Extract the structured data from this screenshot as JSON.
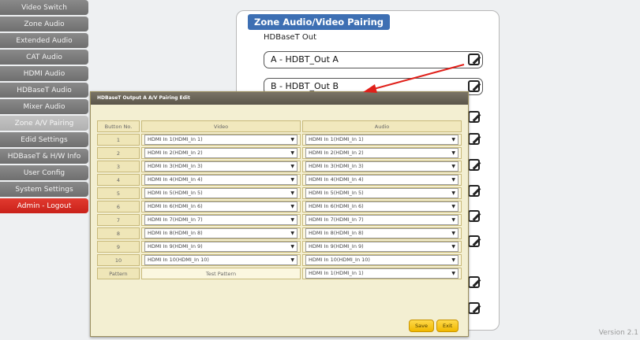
{
  "sidebar": {
    "items": [
      {
        "label": "Video Switch"
      },
      {
        "label": "Zone Audio"
      },
      {
        "label": "Extended Audio"
      },
      {
        "label": "CAT Audio"
      },
      {
        "label": "HDMI Audio"
      },
      {
        "label": "HDBaseT Audio"
      },
      {
        "label": "Mixer Audio"
      },
      {
        "label": "Zone A/V Pairing"
      },
      {
        "label": "Edid Settings"
      },
      {
        "label": "HDBaseT & H/W Info"
      },
      {
        "label": "User Config"
      },
      {
        "label": "System Settings"
      },
      {
        "label": "Admin - Logout"
      }
    ]
  },
  "zone": {
    "title": "Zone Audio/Video Pairing",
    "section_label": "HDBaseT Out",
    "rows": [
      {
        "label": "A - HDBT_Out A"
      },
      {
        "label": "B - HDBT_Out B"
      }
    ]
  },
  "modal": {
    "title": "HDBaseT Output A A/V Pairing Edit",
    "headers": {
      "button_no": "Button No.",
      "video": "Video",
      "audio": "Audio"
    },
    "rows": [
      {
        "num": "1",
        "video": "HDMI In 1(HDMI_In 1)",
        "audio": "HDMI In 1(HDMI_In 1)"
      },
      {
        "num": "2",
        "video": "HDMI In 2(HDMI_In 2)",
        "audio": "HDMI In 2(HDMI_In 2)"
      },
      {
        "num": "3",
        "video": "HDMI In 3(HDMI_In 3)",
        "audio": "HDMI In 3(HDMI_In 3)"
      },
      {
        "num": "4",
        "video": "HDMI In 4(HDMI_In 4)",
        "audio": "HDMI In 4(HDMI_In 4)"
      },
      {
        "num": "5",
        "video": "HDMI In 5(HDMI_In 5)",
        "audio": "HDMI In 5(HDMI_In 5)"
      },
      {
        "num": "6",
        "video": "HDMI In 6(HDMI_In 6)",
        "audio": "HDMI In 6(HDMI_In 6)"
      },
      {
        "num": "7",
        "video": "HDMI In 7(HDMI_In 7)",
        "audio": "HDMI In 7(HDMI_In 7)"
      },
      {
        "num": "8",
        "video": "HDMI In 8(HDMI_In 8)",
        "audio": "HDMI In 8(HDMI_In 8)"
      },
      {
        "num": "9",
        "video": "HDMI In 9(HDMI_In 9)",
        "audio": "HDMI In 9(HDMI_In 9)"
      },
      {
        "num": "10",
        "video": "HDMI In 10(HDMI_In 10)",
        "audio": "HDMI In 10(HDMI_In 10)"
      }
    ],
    "pattern_row": {
      "label": "Pattern",
      "video": "Test Pattern",
      "audio": "HDMI In 1(HDMI_In 1)"
    },
    "save_label": "Save",
    "exit_label": "Exit"
  },
  "footer": {
    "version": "Version 2.1"
  },
  "colors": {
    "accent": "#3d6fb3",
    "logout": "#d42a22",
    "annotation_arrow": "#e0201a",
    "button": "#f5c518"
  }
}
